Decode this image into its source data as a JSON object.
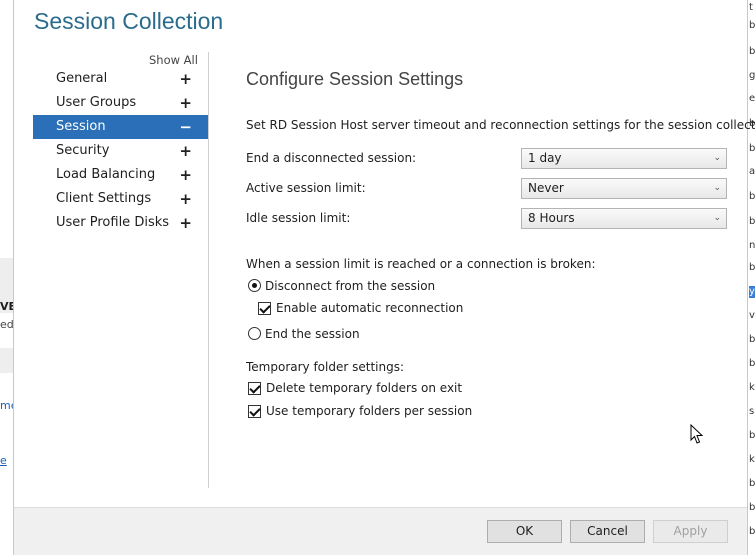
{
  "dialog": {
    "title": "Session Collection",
    "show_all": "Show All"
  },
  "nav": {
    "items": [
      {
        "label": "General",
        "toggle": "+"
      },
      {
        "label": "User Groups",
        "toggle": "+"
      },
      {
        "label": "Session",
        "toggle": "−"
      },
      {
        "label": "Security",
        "toggle": "+"
      },
      {
        "label": "Load Balancing",
        "toggle": "+"
      },
      {
        "label": "Client Settings",
        "toggle": "+"
      },
      {
        "label": "User Profile Disks",
        "toggle": "+"
      }
    ],
    "selected": "Session"
  },
  "session": {
    "title": "Configure Session Settings",
    "description": "Set RD Session Host server timeout and reconnection settings for the session collection.",
    "rows": [
      {
        "label": "End a disconnected session:",
        "value": "1 day"
      },
      {
        "label": "Active session limit:",
        "value": "Never"
      },
      {
        "label": "Idle session limit:",
        "value": "8 Hours"
      }
    ],
    "limit_heading": "When a session limit is reached or a connection is broken:",
    "disconnect_label": "Disconnect from the session",
    "disconnect_selected": true,
    "auto_reconnect_label": "Enable automatic reconnection",
    "auto_reconnect_checked": true,
    "end_session_label": "End the session",
    "end_session_selected": false,
    "temp_heading": "Temporary folder settings:",
    "delete_temp_label": "Delete temporary folders on exit",
    "delete_temp_checked": true,
    "use_temp_label": "Use temporary folders per session",
    "use_temp_checked": true
  },
  "footer": {
    "ok": "OK",
    "cancel": "Cancel",
    "apply": "Apply",
    "apply_enabled": false
  },
  "background": {
    "left_fragments": [
      "VE",
      "ed",
      "me",
      "e"
    ],
    "right_fragments": [
      "t",
      "b",
      "b",
      "g",
      "e",
      "b",
      "b",
      "ar",
      "b",
      "b",
      "ne",
      "b",
      "b",
      "le",
      "y",
      "vi",
      "b",
      "b",
      "g",
      "ko",
      "b",
      "sa",
      "b",
      "b",
      "kc",
      "b",
      "b",
      "b"
    ]
  },
  "colors": {
    "accent": "#2a6fb8",
    "title": "#2b6c8c"
  },
  "icons": {
    "cursor": "mouse-pointer-icon"
  }
}
